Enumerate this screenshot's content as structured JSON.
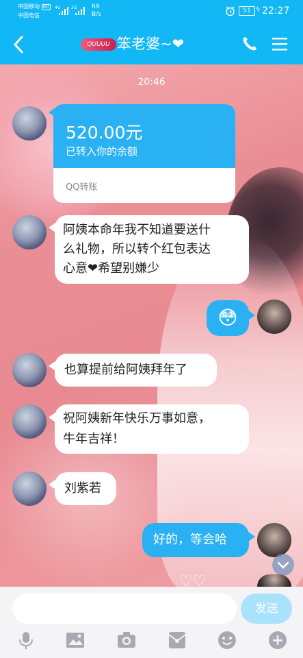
{
  "status_bar": {
    "carrier1": "中国移动",
    "carrier1_badge": "HD",
    "carrier2": "中国电信",
    "net1": "4G",
    "net2": "2G",
    "speed_value": "69",
    "speed_unit": "B/s",
    "battery": "51",
    "time": "22:27"
  },
  "header": {
    "title": "笨老婆~❤",
    "back_label": "<",
    "badge_text": "QUUUU"
  },
  "chat": {
    "timestamp": "20:46",
    "messages": [
      {
        "from": "her",
        "type": "transfer",
        "amount": "520.00元",
        "desc": "已转入你的余额",
        "footer": "QQ转账"
      },
      {
        "from": "her",
        "type": "text",
        "line1": "阿姨本命年我不知道要送什",
        "line2": "么礼物，所以转个红包表达",
        "line3": "心意❤希望别嫌少"
      },
      {
        "from": "me",
        "type": "emoji",
        "emoji": "😳"
      },
      {
        "from": "her",
        "type": "text",
        "text": "也算提前给阿姨拜年了"
      },
      {
        "from": "her",
        "type": "text",
        "line1": "祝阿姨新年快乐万事如意，",
        "line2": "牛年吉祥！"
      },
      {
        "from": "her",
        "type": "text",
        "text": "刘紫若"
      },
      {
        "from": "me",
        "type": "text",
        "text": "好的，等会哈"
      }
    ]
  },
  "input": {
    "send_label": "发送",
    "placeholder": ""
  },
  "toolbar": {
    "icons": [
      "mic-icon",
      "image-icon",
      "camera-icon",
      "red-packet-icon",
      "emoji-icon",
      "plus-icon"
    ]
  },
  "colors": {
    "brand": "#12b7f5",
    "my_bubble": "#2ab1f3",
    "send_disabled": "#a8e2fb"
  }
}
